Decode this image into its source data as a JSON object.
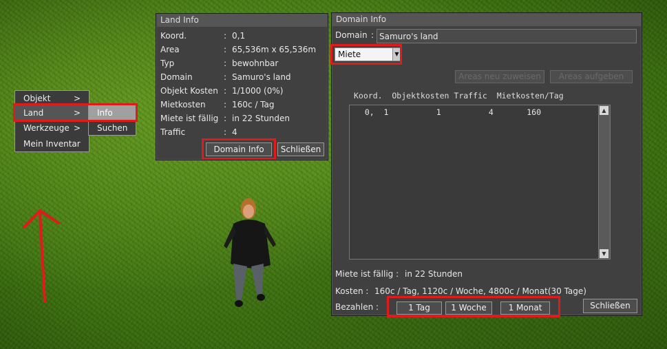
{
  "context_menu": {
    "items": [
      {
        "label": "Objekt",
        "arrow": ">"
      },
      {
        "label": "Land",
        "arrow": ">"
      },
      {
        "label": "Werkzeuge",
        "arrow": ">"
      },
      {
        "label": "Mein Inventar",
        "arrow": ""
      }
    ],
    "submenu": [
      "Info",
      "Suchen"
    ]
  },
  "land_info": {
    "title": "Land Info",
    "rows": [
      {
        "key": "Koord.",
        "value": "0,1"
      },
      {
        "key": "Area",
        "value": "65,536m x 65,536m"
      },
      {
        "key": "Typ",
        "value": "bewohnbar"
      },
      {
        "key": "Domain",
        "value": "Samuro's land"
      },
      {
        "key": "Objekt Kosten",
        "value": "1/1000 (0%)"
      },
      {
        "key": "Mietkosten",
        "value": "160c / Tag"
      },
      {
        "key": "Miete ist fällig",
        "value": "in 22 Stunden"
      },
      {
        "key": "Traffic",
        "value": "4"
      }
    ],
    "domain_info_button": "Domain Info",
    "close_button": "Schließen"
  },
  "domain_info": {
    "title": "Domain Info",
    "domain_label": "Domain",
    "domain_value": "Samuro's land",
    "dropdown_value": "Miete",
    "reassign_button": "Areas neu zuweisen",
    "abandon_button": "Areas aufgeben",
    "table_header": "Koord.  Objektkosten Traffic  Mietkosten/Tag",
    "table_rows": [
      "  0,  1          1          4       160"
    ],
    "due_label": "Miete ist fällig :",
    "due_value": "in 22 Stunden",
    "cost_label": "Kosten :",
    "cost_value": "160c / Tag, 1120c / Woche, 4800c / Monat(30 Tage)",
    "pay_label": "Bezahlen :",
    "pay_buttons": [
      "1 Tag",
      "1 Woche",
      "1 Monat"
    ],
    "close_button": "Schließen"
  },
  "colors": {
    "highlight": "#e01b1b",
    "panel": "#404040",
    "menu_selected": "#a0a0a0"
  }
}
